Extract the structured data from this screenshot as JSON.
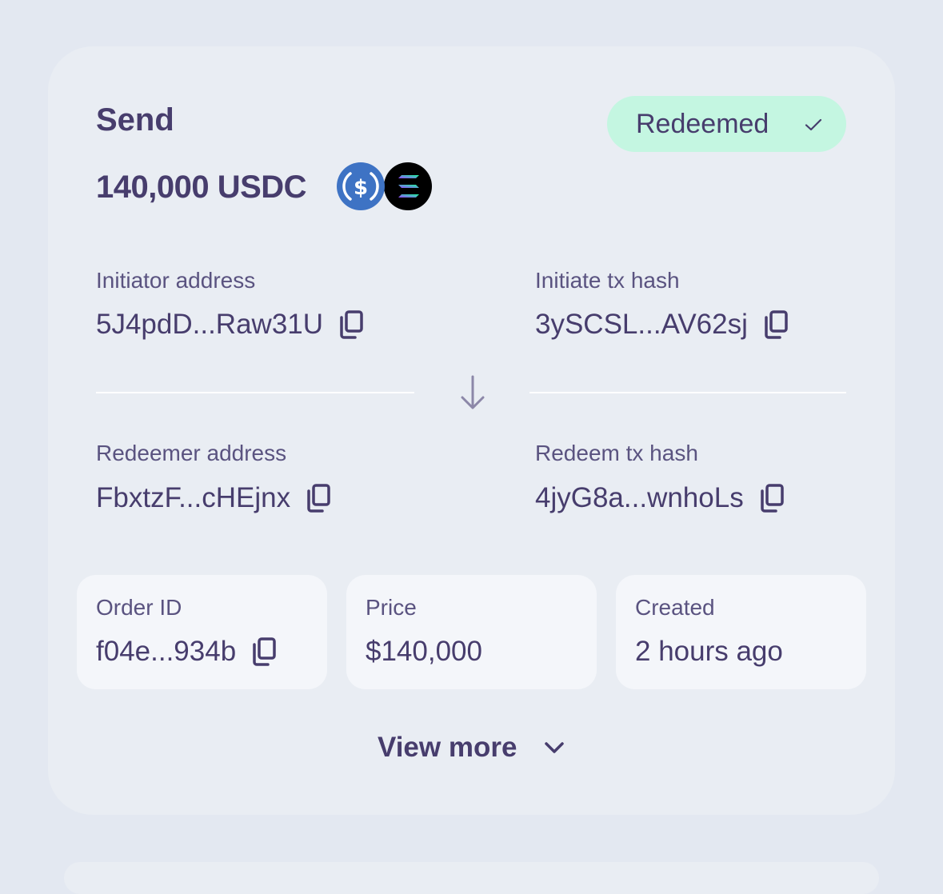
{
  "card": {
    "title": "Send",
    "amount": "140,000 USDC",
    "token_icons": [
      "usdc-icon",
      "solana-icon"
    ],
    "status": {
      "label": "Redeemed",
      "icon": "check-icon",
      "color": "#c4f6e1"
    }
  },
  "fields": {
    "initiator_address": {
      "label": "Initiator address",
      "value": "5J4pdD...Raw31U"
    },
    "initiate_tx_hash": {
      "label": "Initiate tx hash",
      "value": "3ySCSL...AV62sj"
    },
    "redeemer_address": {
      "label": "Redeemer address",
      "value": "FbxtzF...cHEjnx"
    },
    "redeem_tx_hash": {
      "label": "Redeem tx hash",
      "value": "4jyG8a...wnhoLs"
    }
  },
  "info": {
    "order_id": {
      "label": "Order ID",
      "value": "f04e...934b"
    },
    "price": {
      "label": "Price",
      "value": "$140,000"
    },
    "created": {
      "label": "Created",
      "value": "2 hours ago"
    }
  },
  "view_more_label": "View more",
  "colors": {
    "text": "#473d6d",
    "background": "#e3e8f1",
    "card": "#e9edf3",
    "usdc": "#3e73c4"
  }
}
